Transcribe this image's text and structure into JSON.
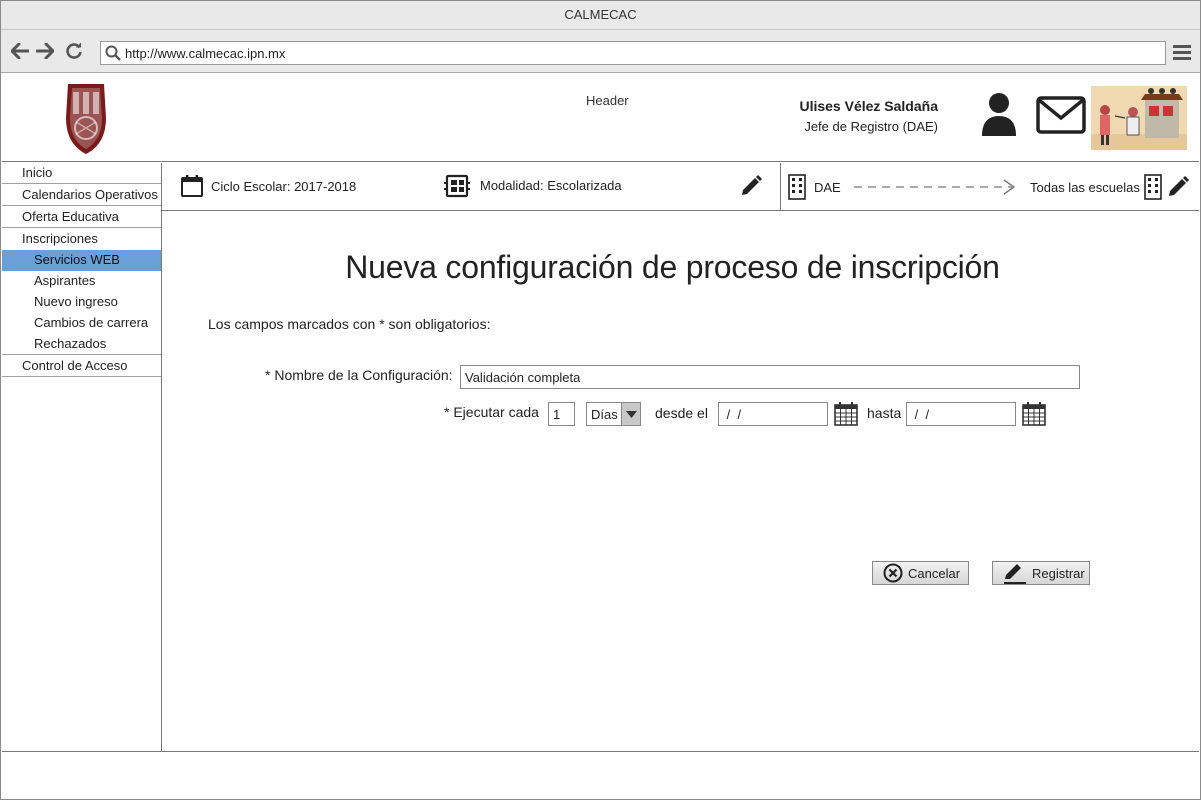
{
  "window": {
    "title": "CALMECAC"
  },
  "browser": {
    "url": "http://www.calmecac.ipn.mx"
  },
  "header": {
    "label": "Header",
    "user_name": "Ulises Vélez Saldaña",
    "user_role": "Jefe de Registro (DAE)"
  },
  "sidebar": {
    "items": [
      {
        "label": "Inicio"
      },
      {
        "label": "Calendarios Operativos"
      },
      {
        "label": "Oferta Educativa"
      },
      {
        "label": "Inscripciones"
      },
      {
        "label": "Servicios WEB",
        "active": true
      },
      {
        "label": "Aspirantes"
      },
      {
        "label": "Nuevo ingreso"
      },
      {
        "label": "Cambios de carrera"
      },
      {
        "label": "Rechazados"
      },
      {
        "label": "Control de Acceso"
      }
    ]
  },
  "context": {
    "ciclo": "Ciclo Escolar: 2017-2018",
    "modalidad": "Modalidad: Escolarizada",
    "origin": "DAE",
    "destination": "Todas las escuelas"
  },
  "main": {
    "title": "Nueva configuración de proceso de inscripción",
    "hint": "Los campos marcados con * son obligatorios:",
    "name_label": "* Nombre de la Configuración:",
    "name_value": "Validación completa",
    "exec_label": "* Ejecutar cada",
    "exec_value": "1",
    "unit_value": "Días",
    "from_label": "desde el",
    "from_value": " /  /",
    "to_label": "hasta",
    "to_value": " /  /",
    "cancel_label": "Cancelar",
    "submit_label": "Registrar"
  },
  "colors": {
    "active_item": "#6aa0d8",
    "border": "#777777",
    "chrome": "#e9e9e9"
  }
}
